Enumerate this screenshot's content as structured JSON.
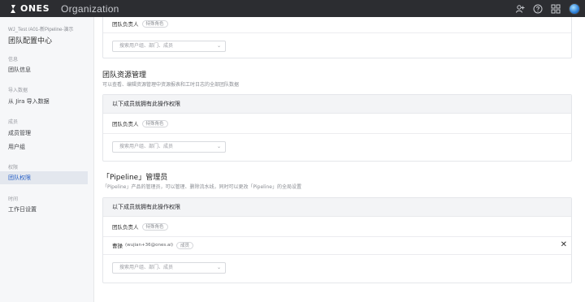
{
  "header": {
    "logo_text": "ONES",
    "org_name": "Organization",
    "icons": [
      "add-member-icon",
      "help-icon",
      "apps-grid-icon",
      "avatar"
    ]
  },
  "sidebar": {
    "breadcrumb": "WJ_Test /A01-新Pipeline-演示",
    "title": "团队配置中心",
    "sections": [
      {
        "label": "信息",
        "items": [
          {
            "label": "团队信息"
          }
        ]
      },
      {
        "label": "导入数据",
        "items": [
          {
            "label": "从 Jira 导入数据"
          }
        ]
      },
      {
        "label": "成员",
        "items": [
          {
            "label": "成员管理"
          },
          {
            "label": "用户组"
          }
        ]
      },
      {
        "label": "权限",
        "items": [
          {
            "label": "团队权限",
            "active": true
          }
        ]
      },
      {
        "label": "时间",
        "items": [
          {
            "label": "工作日设置"
          }
        ]
      }
    ]
  },
  "top_card": {
    "owner_label": "团队负责人",
    "owner_badge": "特殊角色",
    "select_placeholder": "搜索用户组、部门、成员"
  },
  "resource_section": {
    "title": "团队资源管理",
    "desc": "可以查看、编辑资源管理中资源报表和工时日志的全部团队数据",
    "card_head": "以下成员就拥有此操作权限",
    "owner_label": "团队负责人",
    "owner_badge": "特殊角色",
    "select_placeholder": "搜索用户组、部门、成员"
  },
  "pipeline_section": {
    "title": "「Pipeline」管理员",
    "desc": "「Pipeline」产品的管理员，可以管理、删除流水线，同时可以更改「Pipeline」的全局设置",
    "card_head": "以下成员就拥有此操作权限",
    "owner_label": "团队负责人",
    "owner_badge": "特殊角色",
    "member_name": "曹操",
    "member_email": "(wujian+36@ones.ai)",
    "member_badge": "成员",
    "select_placeholder": "搜索用户组、部门、成员"
  },
  "colors": {
    "header_bg": "#2c2d31",
    "active_item_bg": "#e3e7ee",
    "active_item_text": "#2860c7"
  }
}
